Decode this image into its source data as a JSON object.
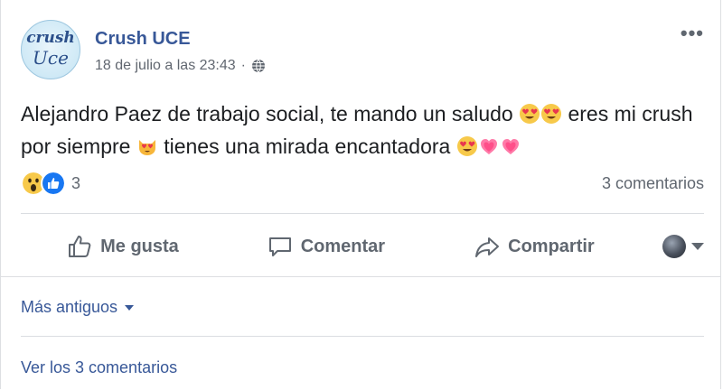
{
  "post": {
    "page_name": "Crush UCE",
    "avatar_text": [
      "crush",
      "Uce"
    ],
    "timestamp": "18 de julio a las 23:43",
    "separator": "·",
    "audience_icon": "globe-icon",
    "more_label": "•••",
    "text_parts": [
      "Alejandro Paez de trabajo social, te mando un saludo ",
      " eres mi crush por siempre ",
      " tienes una mirada encantadora "
    ],
    "emojis": [
      "heart-eyes-emoji",
      "heart-eyes-emoji",
      "heart-eyes-cat-emoji",
      "heart-eyes-emoji",
      "pink-heart-emoji",
      "pink-heart-emoji"
    ]
  },
  "reactions": {
    "icons": [
      "wow-icon",
      "like-icon"
    ],
    "count": "3",
    "comments_label": "3 comentarios"
  },
  "actions": {
    "like": "Me gusta",
    "comment": "Comentar",
    "share": "Compartir"
  },
  "comments": {
    "sort_label": "Más antiguos",
    "view_all": "Ver los 3 comentarios"
  },
  "colors": {
    "link": "#385898",
    "muted": "#606770",
    "like_blue": "#1877f2",
    "wow_yellow": "#f7c94a",
    "divider": "#dadde1"
  }
}
